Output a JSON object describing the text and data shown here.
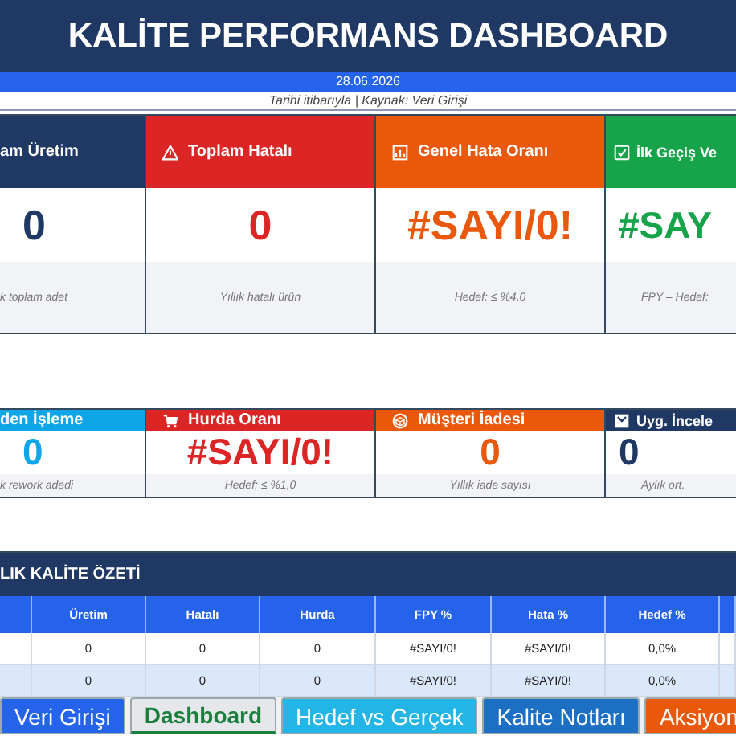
{
  "title": "KALİTE PERFORMANS DASHBOARD",
  "date": "28.06.2026",
  "subtitle": "Tarihi itibarıyla | Kaynak: Veri Girişi",
  "kpi_cards": [
    {
      "label": "am Üretim",
      "value": "0",
      "note": "k toplam adet",
      "color": "#1f3864"
    },
    {
      "label": "Toplam Hatalı",
      "value": "0",
      "note": "Yıllık hatalı ürün",
      "color": "#dc2626"
    },
    {
      "label": "Genel Hata Oranı",
      "value": "#SAYI/0!",
      "note": "Hedef: ≤ %4,0",
      "color": "#ea580c"
    },
    {
      "label": "İlk Geçiş Ve",
      "value": "#SAY",
      "note": "FPY – Hedef:",
      "color": "#16a34a"
    }
  ],
  "small_cards": [
    {
      "label": "den İşleme",
      "value": "0",
      "note": "k rework adedi",
      "color": "#0ea5e9"
    },
    {
      "label": "Hurda Oranı",
      "value": "#SAYI/0!",
      "note": "Hedef: ≤ %1,0",
      "color": "#dc2626"
    },
    {
      "label": "Müşteri İadesi",
      "value": "0",
      "note": "Yıllık iade sayısı",
      "color": "#ea580c"
    },
    {
      "label": "Uyg. İncele",
      "value": "0",
      "note": "Aylık ort.",
      "color": "#1f3864"
    }
  ],
  "summary": {
    "title": "LIK KALİTE ÖZETİ",
    "columns": [
      "Üretim",
      "Hatalı",
      "Hurda",
      "FPY %",
      "Hata %",
      "Hedef %"
    ],
    "rows": [
      [
        "0",
        "0",
        "0",
        "#SAYI/0!",
        "#SAYI/0!",
        "0,0%"
      ],
      [
        "0",
        "0",
        "0",
        "#SAYI/0!",
        "#SAYI/0!",
        "0,0%"
      ]
    ]
  },
  "sheet_tabs": [
    {
      "label": "Veri Girişi",
      "selected": false,
      "color": "#2563eb"
    },
    {
      "label": "Dashboard",
      "selected": true,
      "color": "#e5e7eb"
    },
    {
      "label": "Hedef vs Gerçek",
      "selected": false,
      "color": "#22b5e6"
    },
    {
      "label": "Kalite Notları",
      "selected": false,
      "color": "#1d6fc4"
    },
    {
      "label": "Aksiyon",
      "selected": false,
      "color": "#ea580c"
    }
  ]
}
